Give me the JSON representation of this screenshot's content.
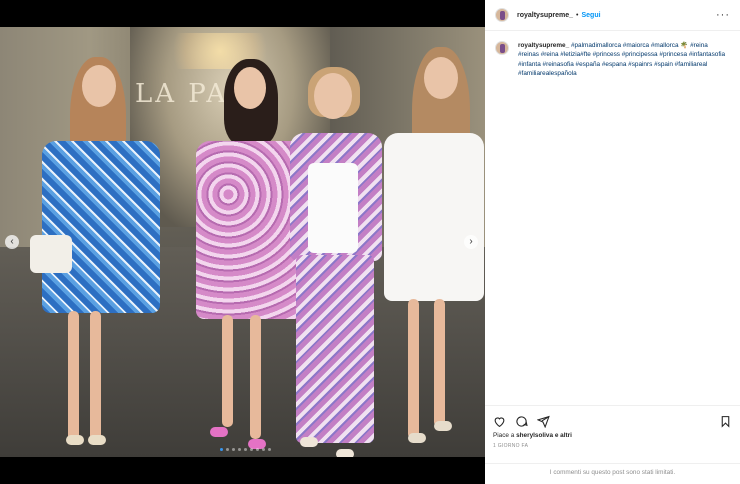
{
  "post": {
    "username": "royaltysupreme_",
    "separator": "•",
    "follow_label": "Segui",
    "more_icon": "more-horizontal-icon",
    "caption_tags": "#palmadimallorca #maiorca #mallorca 🌴 #reina #reinas #reina #letizia#fte #princess #principessa #princesa #infantasofia #infanta #reinasofia #españa #espana #spainrs #spain #familiareal #familiarealespañola",
    "likes_prefix": "Piace a ",
    "likes_user": "sherylsoliva",
    "likes_suffix": " e altri",
    "time": "1 GIORNO FA",
    "comments_disabled": "I commenti su questo post sono stati limitati.",
    "photo_sign": "LA PA"
  },
  "carousel": {
    "prev_icon": "chevron-left-icon",
    "next_icon": "chevron-right-icon",
    "dot_count": 9,
    "active_dot": 0
  },
  "colors": {
    "link": "#0095f6",
    "hashtag": "#00376b",
    "muted": "#8e8e8e"
  }
}
